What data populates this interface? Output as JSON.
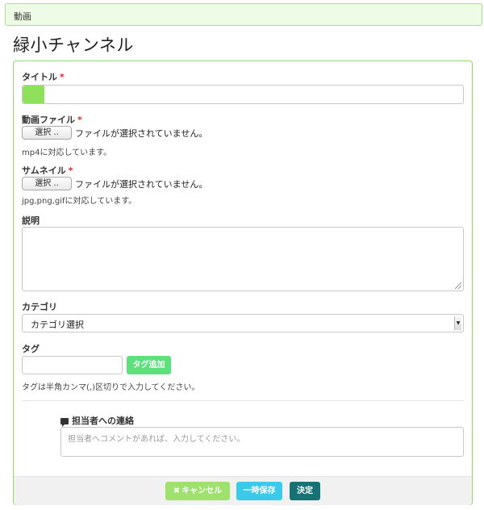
{
  "breadcrumb": "動画",
  "page_title": "緑小チャンネル",
  "form": {
    "title": {
      "label": "タイトル",
      "required": "*",
      "value": "",
      "progress": 0.05
    },
    "video_file": {
      "label": "動画ファイル",
      "required": "*",
      "button": "選択 ..",
      "status": "ファイルが選択されていません。",
      "help": "mp4に対応しています。"
    },
    "thumbnail": {
      "label": "サムネイル",
      "required": "*",
      "button": "選択 ..",
      "status": "ファイルが選択されていません。",
      "help": "jpg,png,gifに対応しています。"
    },
    "description": {
      "label": "説明",
      "value": ""
    },
    "category": {
      "label": "カテゴリ",
      "selected": "カテゴリ選択"
    },
    "tags": {
      "label": "タグ",
      "value": "",
      "add_button": "タグ追加",
      "help": "タグは半角カンマ(,)区切りで入力してください。"
    },
    "contact": {
      "label": "担当者への連絡",
      "placeholder": "担当者へコメントがあれば、入力してください。"
    }
  },
  "footer": {
    "cancel": "キャンセル",
    "save_draft": "一時保存",
    "submit": "決定"
  },
  "colors": {
    "accent_green": "#9ee26d",
    "save_blue": "#3ccaeb",
    "submit_teal": "#177276",
    "panel_border": "#8ed96a"
  },
  "icons": {
    "chat": "comment-icon",
    "cancel": "close-icon",
    "select_arrow": "chevron-down-icon"
  }
}
